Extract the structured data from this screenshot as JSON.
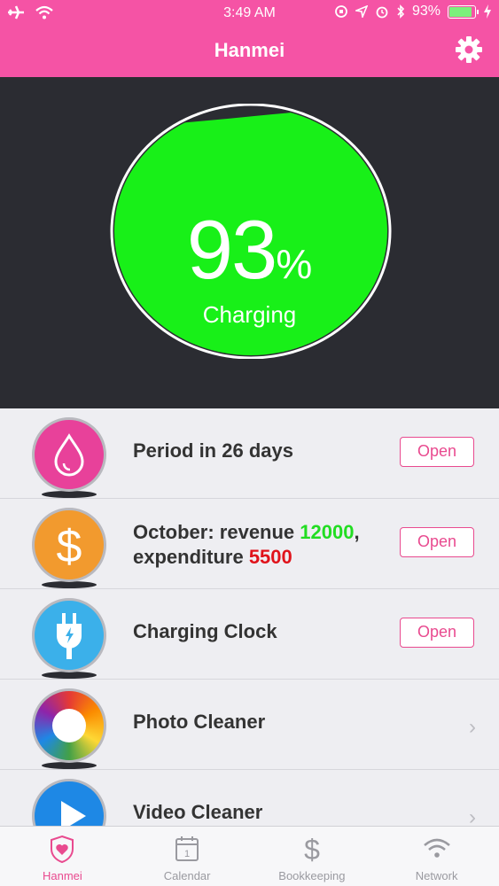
{
  "status": {
    "time": "3:49 AM",
    "battery_text": "93%",
    "battery_level": 0.93
  },
  "nav": {
    "title": "Hanmei"
  },
  "hero": {
    "percent": "93",
    "percent_sign": "%",
    "state": "Charging",
    "fill_color": "#18f018"
  },
  "list": [
    {
      "label": "Period in 26 days",
      "action": "Open",
      "icon": "drop-icon",
      "color": "#e8419a"
    },
    {
      "label_prefix": "October: revenue ",
      "revenue": "12000",
      "mid": ",",
      "label_line2": "expenditure ",
      "expenditure": "5500",
      "action": "Open",
      "icon": "dollar-icon",
      "color": "#f29a2e"
    },
    {
      "label": "Charging Clock",
      "action": "Open",
      "icon": "plug-icon",
      "color": "#3bb0ea"
    },
    {
      "label": "Photo Cleaner",
      "icon": "photo-wheel-icon"
    },
    {
      "label": "Video Cleaner",
      "icon": "play-icon",
      "color": "#1e88e5"
    }
  ],
  "tabs": [
    {
      "label": "Hanmei",
      "icon": "shield-heart-icon",
      "active": true
    },
    {
      "label": "Calendar",
      "icon": "calendar-icon",
      "day": "1"
    },
    {
      "label": "Bookkeeping",
      "icon": "dollar-icon"
    },
    {
      "label": "Network",
      "icon": "wifi-icon"
    }
  ],
  "colors": {
    "accent": "#f553a5",
    "revenue": "#22dd22",
    "expenditure": "#e0131b"
  }
}
